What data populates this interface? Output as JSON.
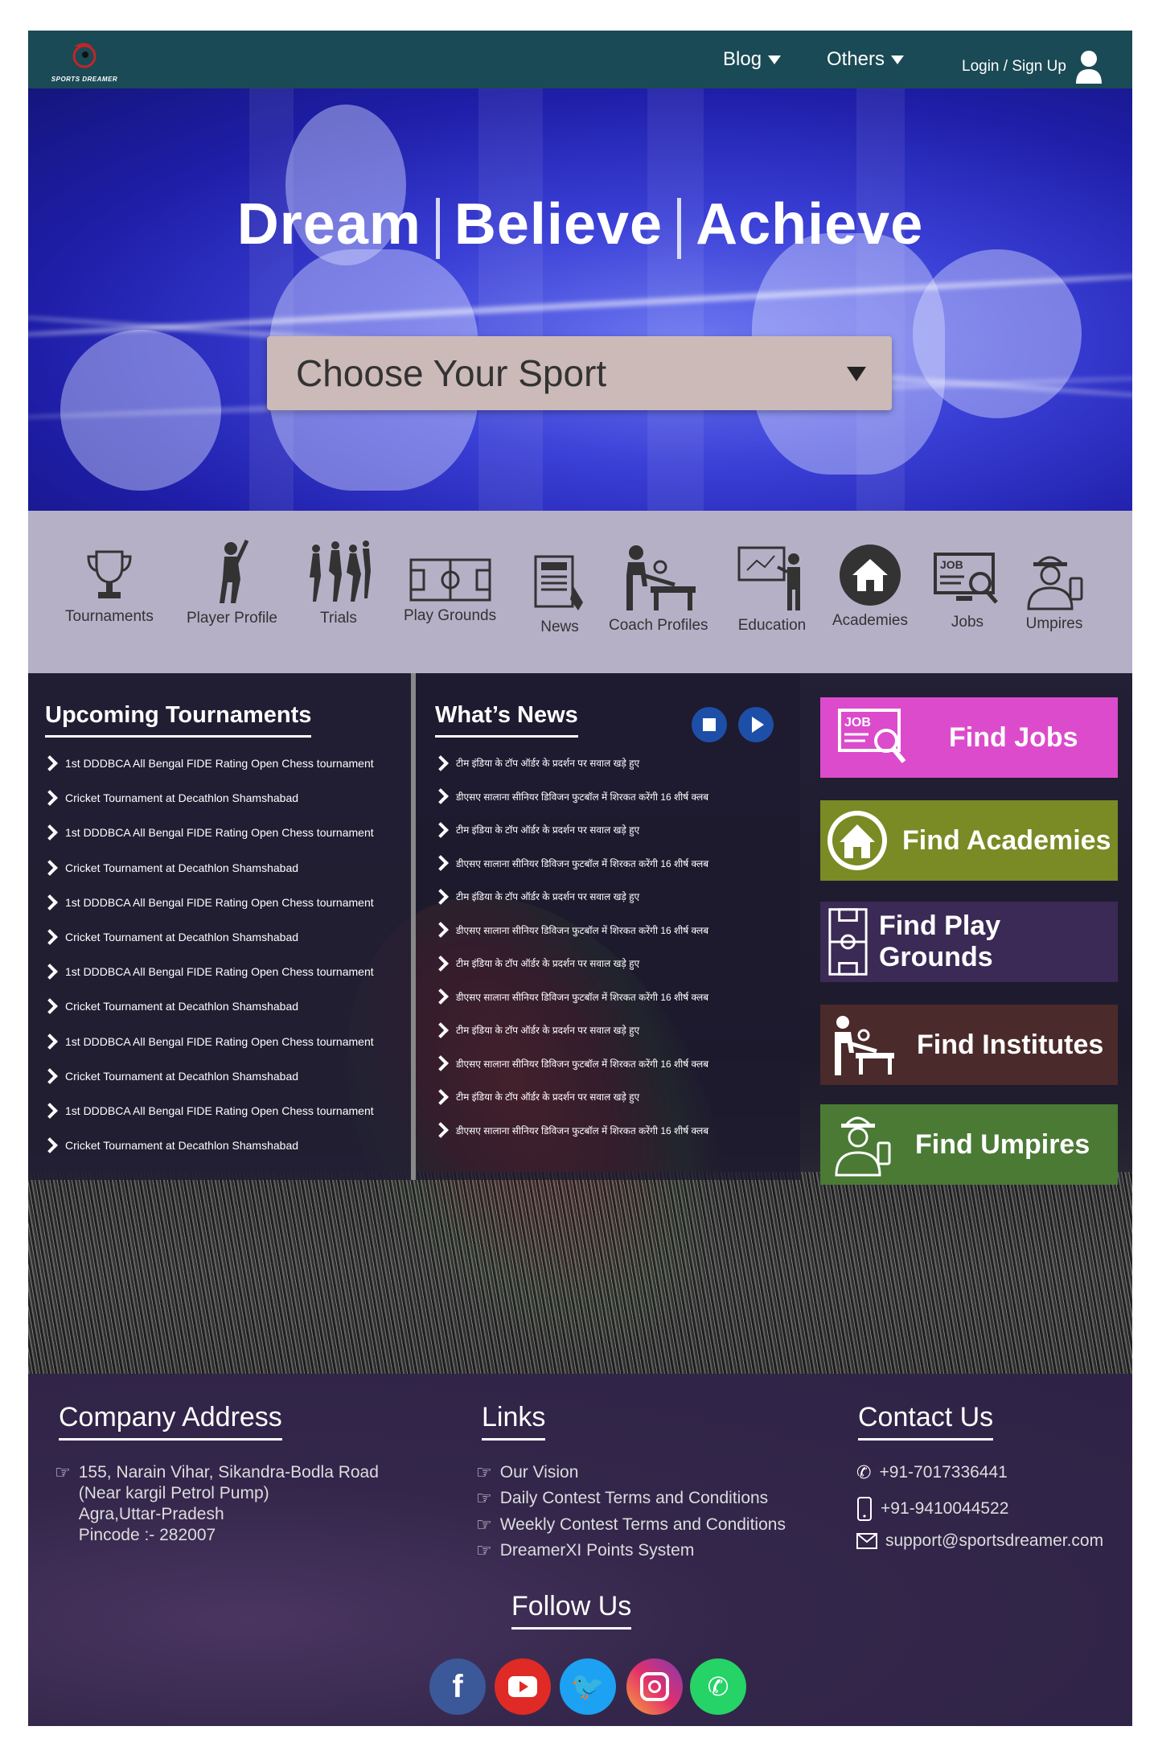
{
  "nav": {
    "logo_text": "SPORTS DREAMER",
    "blog": "Blog",
    "others": "Others",
    "login": "Login / Sign Up"
  },
  "hero": {
    "title_1": "Dream",
    "title_2": "Believe",
    "title_3": "Achieve",
    "select_placeholder": "Choose Your Sport"
  },
  "categories": [
    {
      "label": "Tournaments",
      "icon": "trophy-icon"
    },
    {
      "label": "Player Profile",
      "icon": "batsman-icon"
    },
    {
      "label": "Trials",
      "icon": "players-icon"
    },
    {
      "label": "Play Grounds",
      "icon": "field-icon"
    },
    {
      "label": "News",
      "icon": "newspaper-icon"
    },
    {
      "label": "Coach Profiles",
      "icon": "coach-icon"
    },
    {
      "label": "Education",
      "icon": "teacher-board-icon"
    },
    {
      "label": "Academies",
      "icon": "home-icon"
    },
    {
      "label": "Jobs",
      "icon": "job-search-icon"
    },
    {
      "label": "Umpires",
      "icon": "umpire-icon"
    }
  ],
  "tournaments": {
    "title": "Upcoming Tournaments",
    "items": [
      "1st DDDBCA All Bengal FIDE Rating Open Chess tournament",
      "Cricket Tournament at Decathlon Shamshabad",
      "1st DDDBCA All Bengal FIDE Rating Open Chess tournament",
      "Cricket Tournament at Decathlon Shamshabad",
      "1st DDDBCA All Bengal FIDE Rating Open Chess tournament",
      "Cricket Tournament at Decathlon Shamshabad",
      "1st DDDBCA All Bengal FIDE Rating Open Chess tournament",
      "Cricket Tournament at Decathlon Shamshabad",
      "1st DDDBCA All Bengal FIDE Rating Open Chess tournament",
      "Cricket Tournament at Decathlon Shamshabad",
      "1st DDDBCA All Bengal FIDE Rating Open Chess tournament",
      "Cricket Tournament at Decathlon Shamshabad"
    ]
  },
  "news": {
    "title": "What’s News",
    "items": [
      "टीम इंडिया के टॉप ऑर्डर के प्रदर्शन पर सवाल खड़े हुए",
      "डीएसए सालाना सीनियर डिविजन फुटबॉल में शिरकत करेंगी 16 शीर्ष क्लब",
      "टीम इंडिया के टॉप ऑर्डर के प्रदर्शन पर सवाल खड़े हुए",
      "डीएसए सालाना सीनियर डिविजन फुटबॉल में शिरकत करेंगी 16 शीर्ष क्लब",
      "टीम इंडिया के टॉप ऑर्डर के प्रदर्शन पर सवाल खड़े हुए",
      "डीएसए सालाना सीनियर डिविजन फुटबॉल में शिरकत करेंगी 16 शीर्ष क्लब",
      "टीम इंडिया के टॉप ऑर्डर के प्रदर्शन पर सवाल खड़े हुए",
      "डीएसए सालाना सीनियर डिविजन फुटबॉल में शिरकत करेंगी 16 शीर्ष क्लब",
      "टीम इंडिया के टॉप ऑर्डर के प्रदर्शन पर सवाल खड़े हुए",
      "डीएसए सालाना सीनियर डिविजन फुटबॉल में शिरकत करेंगी 16 शीर्ष क्लब",
      "टीम इंडिया के टॉप ऑर्डर के प्रदर्शन पर सवाल खड़े हुए",
      "डीएसए सालाना सीनियर डिविजन फुटबॉल में शिरकत करेंगी 16 शीर्ष क्लब"
    ]
  },
  "find": [
    {
      "label": "Find Jobs",
      "color": "#dc4bcb",
      "icon": "job-search-icon"
    },
    {
      "label": "Find Academies",
      "color": "#7a8a24",
      "icon": "home-icon"
    },
    {
      "label": "Find Play Grounds",
      "color": "#3a2a55",
      "icon": "field-icon"
    },
    {
      "label": "Find Institutes",
      "color": "#4a2a2a",
      "icon": "coach-icon"
    },
    {
      "label": "Find Umpires",
      "color": "#4a7a34",
      "icon": "umpire-icon"
    }
  ],
  "footer": {
    "address_title": "Company Address",
    "address_lines": [
      "155, Narain Vihar, Sikandra-Bodla Road",
      "(Near kargil Petrol Pump)",
      "Agra,Uttar-Pradesh",
      "Pincode :- 282007"
    ],
    "links_title": "Links",
    "links": [
      "Our Vision",
      "Daily Contest Terms and Conditions",
      "Weekly Contest Terms and Conditions",
      "DreamerXI Points System"
    ],
    "contact_title": "Contact Us",
    "phone_1": "+91-7017336441",
    "phone_2": "+91-9410044522",
    "email": "support@sportsdreamer.com",
    "follow_title": "Follow Us"
  },
  "colors": {
    "nav": "#1a4a55",
    "category_bar": "#b6b0c7",
    "facebook": "#3b5998",
    "youtube": "#e02a26",
    "twitter": "#1da1f2",
    "instagram": "#c13584",
    "whatsapp": "#25d366"
  }
}
